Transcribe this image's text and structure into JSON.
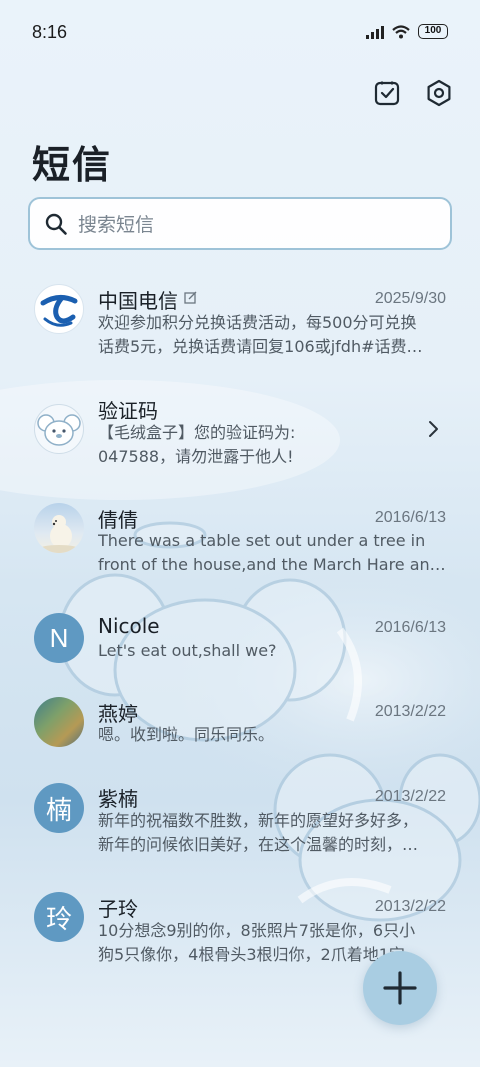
{
  "status_bar": {
    "time": "8:16",
    "battery": "100",
    "icons": [
      "signal-icon",
      "wifi-icon",
      "battery-icon"
    ]
  },
  "top_actions": {
    "icons": [
      "select-checkbox-icon",
      "settings-hexagon-icon"
    ]
  },
  "page": {
    "title": "短信"
  },
  "search": {
    "placeholder": "搜索短信"
  },
  "conversations": [
    {
      "name": "中国电信",
      "date": "2025/9/30",
      "line1": "欢迎参加积分兑换话费活动，每500分可兑换",
      "line2": "话费5元，兑换话费请回复106或jfdh#话费…",
      "avatar": "china-telecom-logo"
    },
    {
      "name": "验证码",
      "date": "",
      "line1": "【毛绒盒子】您的验证码为:",
      "line2": "047588，请勿泄露于他人!",
      "avatar": "cartoon-avatar"
    },
    {
      "name": "倩倩",
      "date": "2016/6/13",
      "line1": "There was a table set out under a tree in",
      "line2": "front of the house,and the March Hare an…",
      "avatar": "polar-bear-photo"
    },
    {
      "name": "Nicole",
      "date": "2016/6/13",
      "line1": "Let's eat out,shall we?",
      "line2": "",
      "avatar_letter": "N"
    },
    {
      "name": "燕婷",
      "date": "2013/2/22",
      "line1": "嗯。收到啦。同乐同乐。",
      "line2": "",
      "avatar": "landscape-photo"
    },
    {
      "name": "紫楠",
      "date": "2013/2/22",
      "line1": "新年的祝福数不胜数，新年的愿望好多好多，",
      "line2": "新年的问候依旧美好，在这个温馨的时刻，…",
      "avatar_letter": "楠"
    },
    {
      "name": "子玲",
      "date": "2013/2/22",
      "line1": "10分想念9别的你，8张照片7张是你，6只小",
      "line2": "狗5只像你，4根骨头3根归你，2爪着地1定…",
      "avatar_letter": "玲"
    }
  ],
  "fab": {
    "icon": "plus-icon"
  },
  "colors": {
    "accent": "#5f99c2",
    "search_border": "#9ec3d8",
    "fab": "#a9cde2",
    "telecom_blue": "#1b5fb0"
  }
}
